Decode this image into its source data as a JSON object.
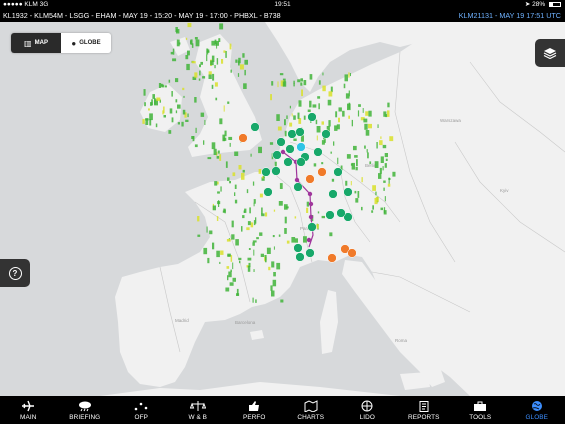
{
  "status_bar": {
    "carrier": "●●●●● KLM  3G",
    "time": "19:51",
    "battery": "28%"
  },
  "flight_bar": {
    "info": "KL1932 - KLM54M - LSGG - EHAM - MAY 19 - 15:20 - MAY 19 - 17:00 - PHBXL - B738",
    "utc": "KLM21131 - MAY 19 17:51 UTC"
  },
  "view_toggle": {
    "map_label": "MAP",
    "globe_label": "GLOBE",
    "active": "map"
  },
  "layers_button": {
    "icon": "layers-icon"
  },
  "help_button": {
    "label": "?"
  },
  "map": {
    "colors": {
      "sea": "#d7d9db",
      "land": "#f1f1f1",
      "route": "#a0369c",
      "green_marker": "#18a86a",
      "orange_marker": "#f07a2a",
      "cyan_marker": "#2ec4e6",
      "radar_green": "#41b43a",
      "radar_yellow": "#d9e02a"
    },
    "weather_stations": [
      {
        "type": "green"
      },
      {
        "type": "green"
      },
      {
        "type": "green"
      },
      {
        "type": "green"
      },
      {
        "type": "orange"
      },
      {
        "type": "green"
      },
      {
        "type": "cyan"
      }
    ]
  },
  "tabs": [
    {
      "label": "MAIN",
      "icon": "airplane-icon",
      "active": false
    },
    {
      "label": "BRIEFING",
      "icon": "weather-cloud-icon",
      "active": false
    },
    {
      "label": "OFP",
      "icon": "route-dots-icon",
      "active": false
    },
    {
      "label": "W & B",
      "icon": "balance-icon",
      "active": false
    },
    {
      "label": "PERFO",
      "icon": "thumbs-up-icon",
      "active": false
    },
    {
      "label": "CHARTS",
      "icon": "charts-icon",
      "active": false
    },
    {
      "label": "LIDO",
      "icon": "lido-icon",
      "active": false
    },
    {
      "label": "REPORTS",
      "icon": "clipboard-icon",
      "active": false
    },
    {
      "label": "TOOLS",
      "icon": "toolbox-icon",
      "active": false
    },
    {
      "label": "GLOBE",
      "icon": "globe-icon",
      "active": true
    }
  ]
}
